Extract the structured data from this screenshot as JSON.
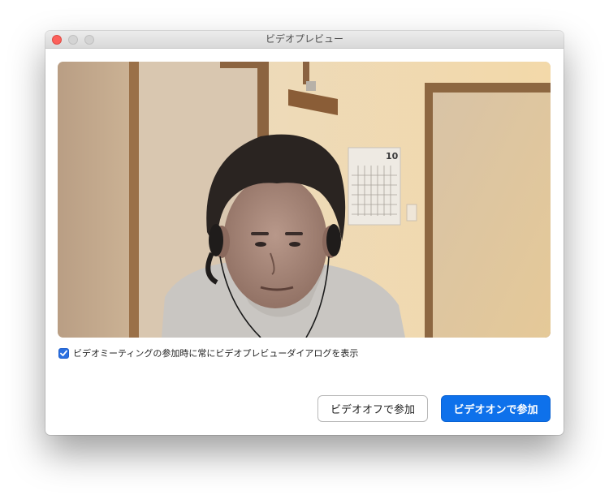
{
  "window": {
    "title": "ビデオプレビュー"
  },
  "preview": {
    "calendar_month": "10"
  },
  "option": {
    "checked": true,
    "label": "ビデオミーティングの参加時に常にビデオプレビューダイアログを表示"
  },
  "buttons": {
    "join_video_off": "ビデオオフで参加",
    "join_video_on": "ビデオオンで参加"
  },
  "colors": {
    "accent": "#0e71eb",
    "close": "#fc605b"
  }
}
